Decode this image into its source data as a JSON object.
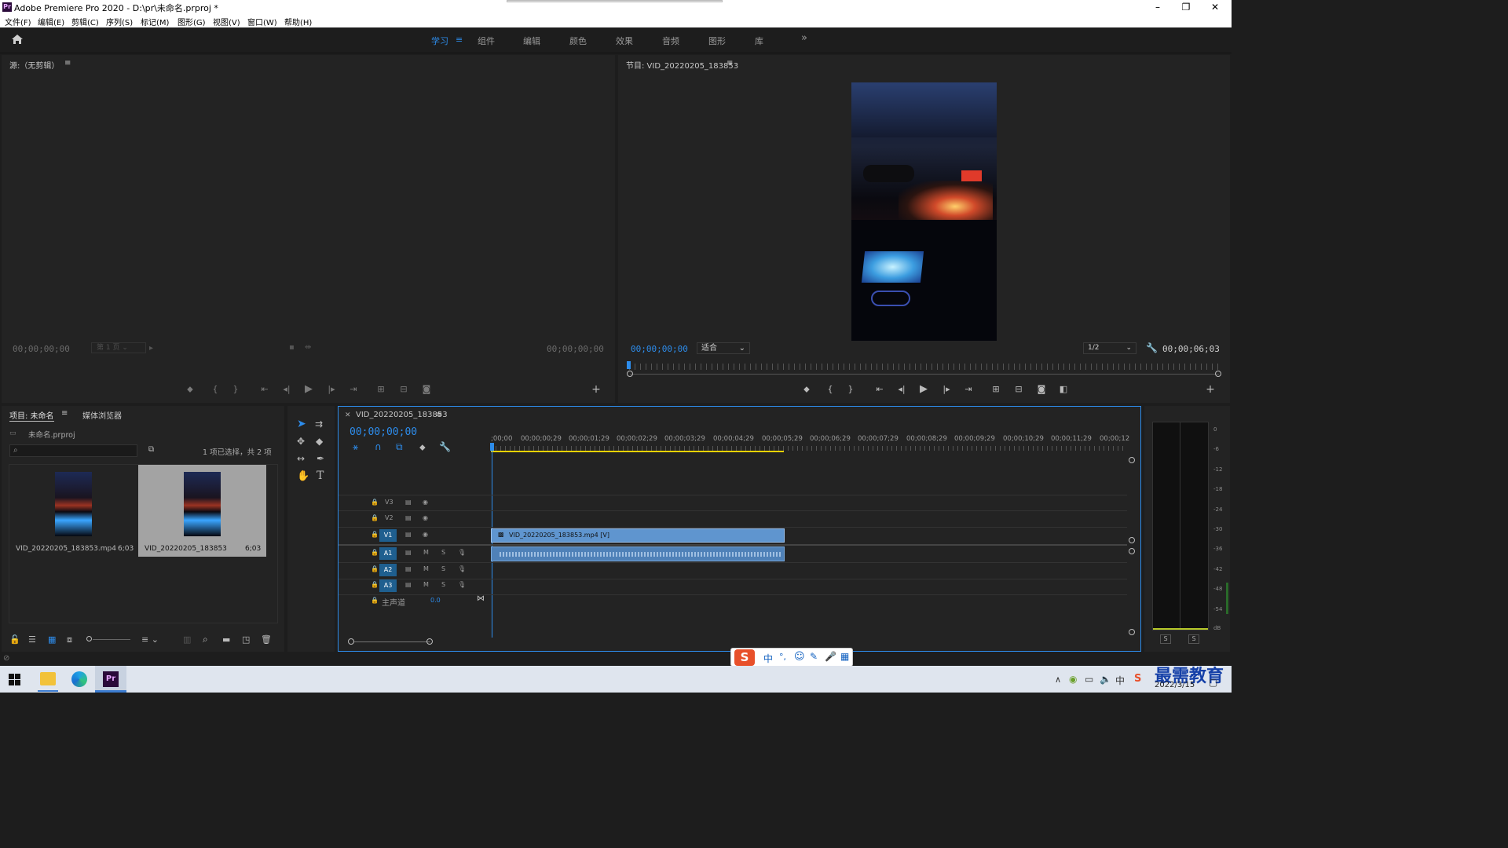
{
  "app": {
    "title": "Adobe Premiere Pro 2020 - D:\\pr\\未命名.prproj *",
    "logo": "Pr"
  },
  "window_controls": {
    "minimize": "–",
    "restore": "❐",
    "close": "✕"
  },
  "menu": [
    "文件(F)",
    "编辑(E)",
    "剪辑(C)",
    "序列(S)",
    "标记(M)",
    "图形(G)",
    "视图(V)",
    "窗口(W)",
    "帮助(H)"
  ],
  "workspaces": {
    "items": [
      "学习",
      "组件",
      "编辑",
      "颜色",
      "效果",
      "音频",
      "图形",
      "库"
    ],
    "active": "学习",
    "more": "»"
  },
  "source": {
    "title": "源:（无剪辑）",
    "tc_left": "00;00;00;00",
    "page": "第 1 页",
    "tc_right": "00;00;00;00"
  },
  "program": {
    "title": "节目: VID_20220205_183853",
    "tc_left": "00;00;00;00",
    "fit": "适合",
    "resolution": "1/2",
    "tc_right": "00;00;06;03"
  },
  "project": {
    "tab_project": "项目: 未命名",
    "tab_media": "媒体浏览器",
    "file": "未命名.prproj",
    "status": "1 项已选择，共 2 项",
    "items": [
      {
        "name": "VID_20220205_183853.mp4",
        "dur": "6;03"
      },
      {
        "name": "VID_20220205_183853",
        "dur": "6;03"
      }
    ]
  },
  "timeline": {
    "tab": "VID_20220205_183853",
    "tc": "00;00;00;00",
    "ruler": [
      ";00;00",
      "00;00;00;29",
      "00;00;01;29",
      "00;00;02;29",
      "00;00;03;29",
      "00;00;04;29",
      "00;00;05;29",
      "00;00;06;29",
      "00;00;07;29",
      "00;00;08;29",
      "00;00;09;29",
      "00;00;10;29",
      "00;00;11;29",
      "00;00;12"
    ],
    "video_tracks": [
      "V3",
      "V2",
      "V1"
    ],
    "audio_tracks": [
      "A1",
      "A2",
      "A3"
    ],
    "mute": "M",
    "solo": "S",
    "master": {
      "label": "主声道",
      "value": "0.0"
    },
    "clip_video": "VID_20220205_183853.mp4 [V]"
  },
  "meter": {
    "labels": [
      "0",
      "-6",
      "-12",
      "-18",
      "-24",
      "-30",
      "-36",
      "-42",
      "-48",
      "-54",
      "dB"
    ],
    "solo_left": "S",
    "solo_right": "S"
  },
  "ime": {
    "logo": "S",
    "items": [
      "中",
      "°,",
      "☺",
      "✎",
      "🎤",
      "▦"
    ]
  },
  "taskbar": {
    "date": "2022/3/15",
    "watermark": "最需教育",
    "pr": "Pr",
    "tray_lang": "中"
  },
  "colors": {
    "accent": "#2d8ceb",
    "timecode": "#2d8ceb",
    "clip": "#5f95cf",
    "yellow": "#e8d200"
  }
}
